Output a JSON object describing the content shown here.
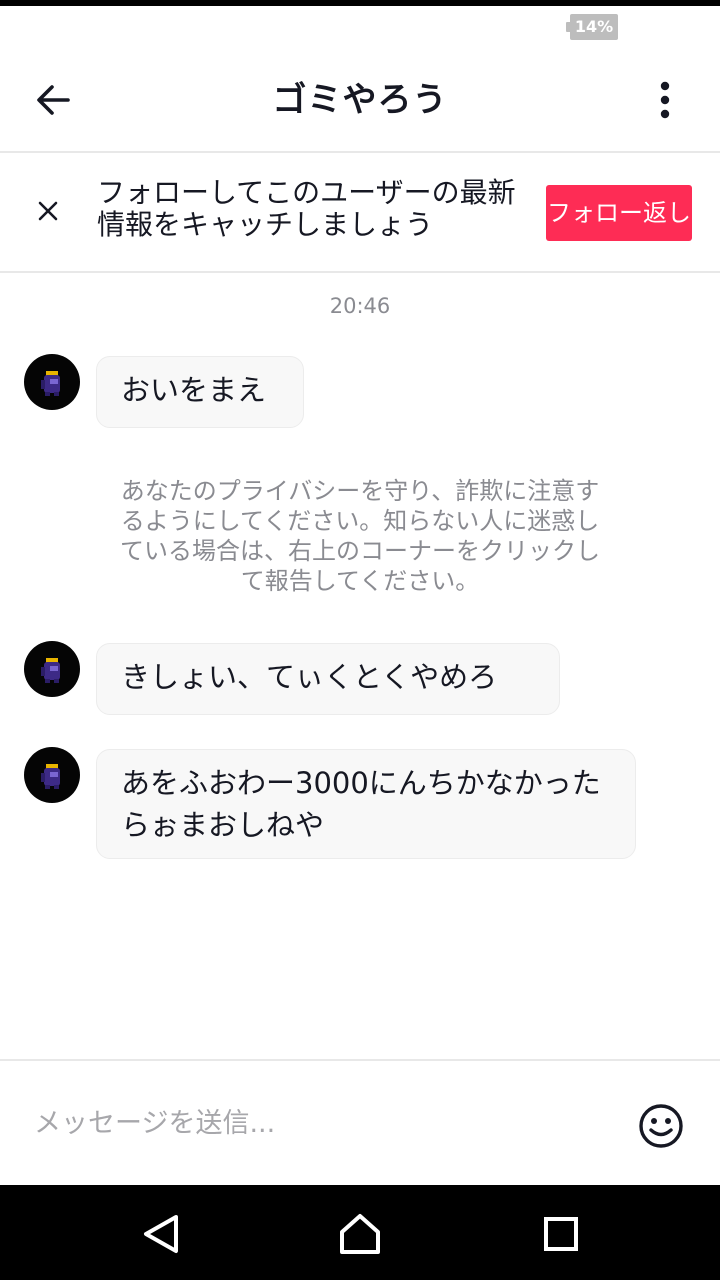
{
  "status_bar": {
    "battery": "14%"
  },
  "header": {
    "title": "ゴミやろう"
  },
  "follow_banner": {
    "text": "フォローしてこのユーザーの最新情報をキャッチしましょう",
    "button": "フォロー返し"
  },
  "chat": {
    "timestamp": "20:46",
    "messages": [
      {
        "text": "おいをまえ"
      },
      {
        "text": "きしょい、てぃくとくやめろ"
      },
      {
        "text": "あをふおわー3000にんちかなかったらぉまおしねや"
      }
    ],
    "privacy_notice": "あなたのプライバシーを守り、詐欺に注意するようにしてください。知らない人に迷惑している場合は、右上のコーナーをクリックして報告してください。"
  },
  "composer": {
    "placeholder": "メッセージを送信..."
  },
  "icons": {
    "back": "back-arrow-icon",
    "more": "more-vertical-icon",
    "close": "close-icon",
    "emoji": "emoji-icon",
    "nav_back": "nav-back-icon",
    "nav_home": "nav-home-icon",
    "nav_recents": "nav-recents-icon"
  },
  "colors": {
    "accent": "#fe2c55",
    "nav_bar": "#000000",
    "bubble": "#f8f8f8"
  }
}
